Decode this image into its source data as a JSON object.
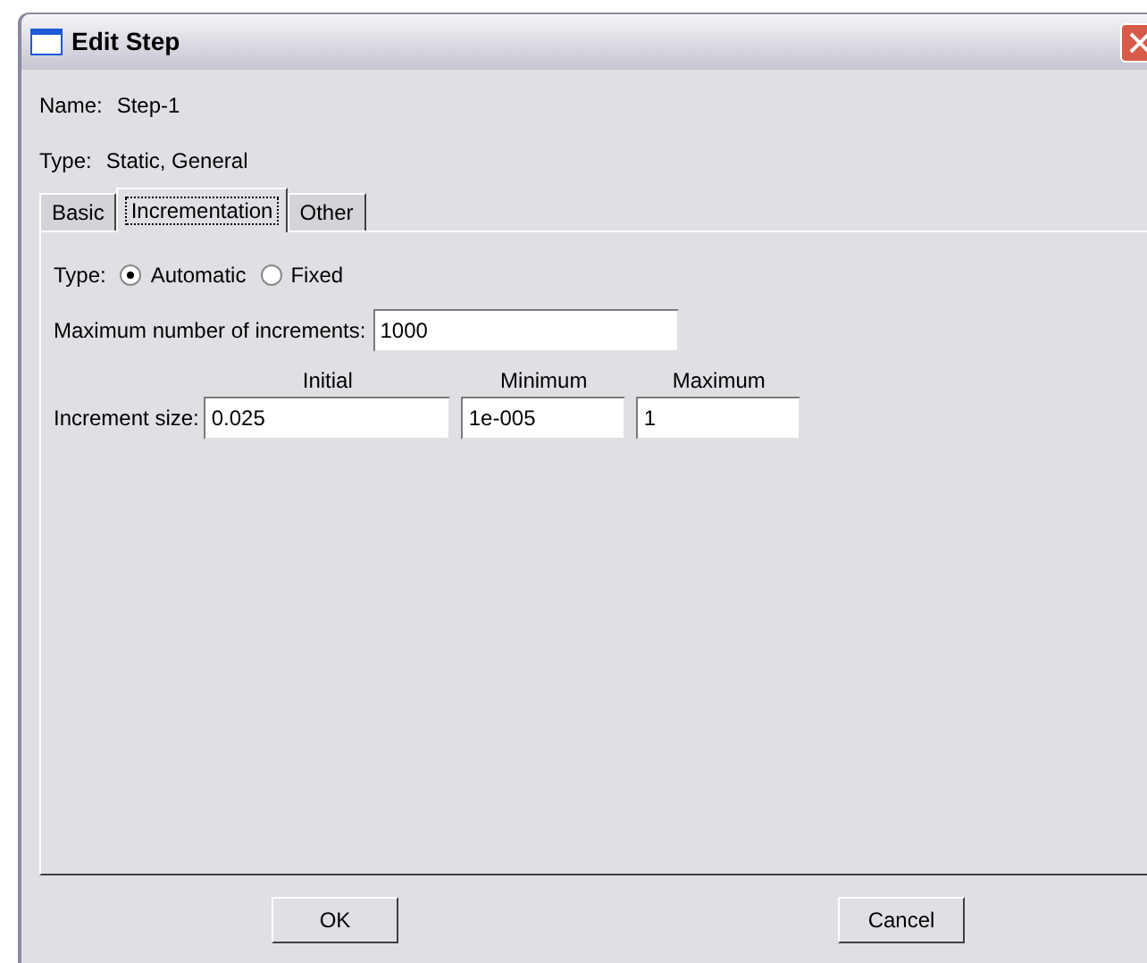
{
  "window": {
    "title": "Edit Step"
  },
  "name": {
    "label": "Name:",
    "value": "Step-1"
  },
  "type": {
    "label": "Type:",
    "value": "Static, General"
  },
  "tabs": [
    {
      "label": "Basic",
      "selected": false
    },
    {
      "label": "Incrementation",
      "selected": true
    },
    {
      "label": "Other",
      "selected": false
    }
  ],
  "increment_type": {
    "label": "Type:",
    "options": [
      {
        "label": "Automatic",
        "selected": true
      },
      {
        "label": "Fixed",
        "selected": false
      }
    ]
  },
  "max_increments": {
    "label": "Maximum number of increments:",
    "value": "1000"
  },
  "increment_size": {
    "label": "Increment size:",
    "columns": [
      {
        "heading": "Initial",
        "value": "0.025"
      },
      {
        "heading": "Minimum",
        "value": "1e-005"
      },
      {
        "heading": "Maximum",
        "value": "1"
      }
    ]
  },
  "buttons": [
    "OK",
    "Cancel"
  ]
}
